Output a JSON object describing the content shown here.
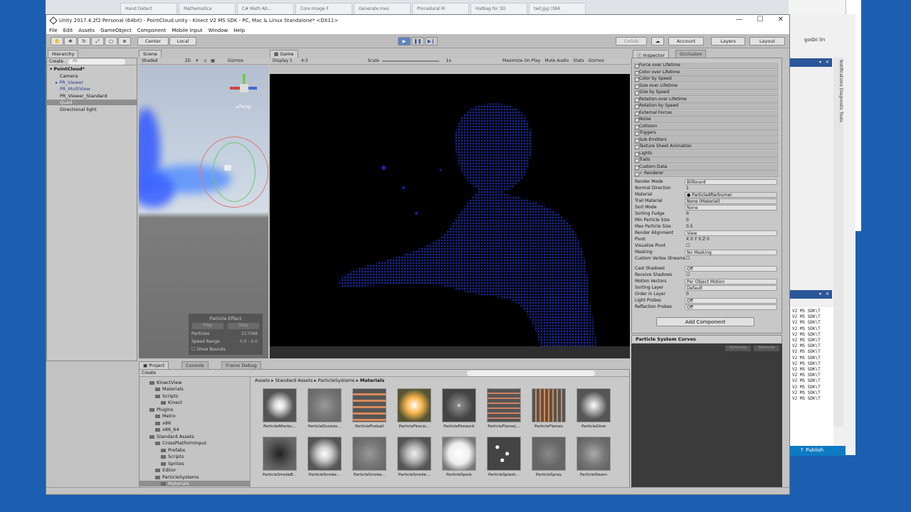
{
  "bg_tabs": [
    "Hand Detect",
    "Mathematica",
    "C# Math Ab...",
    "Core Image F",
    "Generate mes",
    "Procedural M",
    "Hatbag for 3D",
    "ted.jpg (384"
  ],
  "vs_window": {
    "user": "godzi lin",
    "sidebar": "Notifications  Diagnostic Tools",
    "list": [
      "V2 MS SDK\\T",
      "V2 MS SDK\\T",
      "V2 MS SDK\\T",
      "V2 MS SDK\\T",
      "V2 MS SDK\\T",
      "V2 MS SDK\\T",
      "V2 MS SDK\\T",
      "V2 MS SDK\\T",
      "V2 MS SDK\\T",
      "V2 MS SDK\\T",
      "V2 MS SDK\\T",
      "V2 MS SDK\\T",
      "V2 MS SDK\\T",
      "V2 MS SDK\\T",
      "V2 MS SDK\\T",
      "V2 MS SDK\\T"
    ],
    "publish": "Publish"
  },
  "window": {
    "title": "Unity 2017.4.2f2 Personal (64bit) - PointCloud.unity - Kinect V2 MS SDK - PC, Mac & Linux Standalone* <DX11>",
    "minimize": "—",
    "maximize": "☐",
    "close": "✕"
  },
  "menu": [
    "File",
    "Edit",
    "Assets",
    "GameObject",
    "Component",
    "Mobile Input",
    "Window",
    "Help"
  ],
  "toolbar": {
    "center": "Center",
    "local": "Local",
    "collab": "Collab",
    "account": "Account",
    "layers": "Layers",
    "layout": "Layout"
  },
  "hierarchy": {
    "tab": "Hierarchy",
    "create": "Create",
    "search": "All",
    "scene": "PointCloud*",
    "items": [
      "Camera",
      "PR_Viewer",
      "PR_MultiView",
      "PR_Viewer_Standard",
      "Quad",
      "Directional light"
    ]
  },
  "scene": {
    "tab": "Scene",
    "shaded": "Shaded",
    "mode2d": "2D",
    "gizmos": "Gizmos",
    "persp": "Persp",
    "particle_effect": {
      "title": "Particle Effect",
      "play": "Play",
      "stop": "Stop",
      "particles_label": "Particles",
      "particles_value": "217088",
      "speed_label": "Speed Range",
      "speed_value": "0.0 - 0.0",
      "bounds_label": "Show Bounds"
    }
  },
  "game": {
    "tab": "Game",
    "display": "Display 1",
    "aspect": "4:3",
    "scale_label": "Scale",
    "scale_value": "1x",
    "maximize": "Maximize On Play",
    "mute": "Mute Audio",
    "stats": "Stats",
    "gizmos": "Gizmos"
  },
  "inspector": {
    "tab": "Inspector",
    "occlusion_tab": "Occlusion",
    "modules": [
      "Force over Lifetime",
      "Color over Lifetime",
      "Color by Speed",
      "Size over Lifetime",
      "Size by Speed",
      "Rotation over Lifetime",
      "Rotation by Speed",
      "External Forces",
      "Noise",
      "Collision",
      "Triggers",
      "Sub Emitters",
      "Texture Sheet Animation",
      "Lights",
      "Trails",
      "Custom Data"
    ],
    "renderer_label": "Renderer",
    "props": [
      {
        "label": "Render Mode",
        "value": "Billboard"
      },
      {
        "label": "Normal Direction",
        "value": "1"
      },
      {
        "label": "Material",
        "value": "ParticleAfterburner"
      },
      {
        "label": "Trail Material",
        "value": "None (Material)"
      },
      {
        "label": "Sort Mode",
        "value": "None"
      },
      {
        "label": "Sorting Fudge",
        "value": "0"
      },
      {
        "label": "Min Particle Size",
        "value": "0"
      },
      {
        "label": "Max Particle Size",
        "value": "0.5"
      },
      {
        "label": "Render Alignment",
        "value": "View"
      },
      {
        "label": "Pivot",
        "value": "X 0     Y 0     Z 0"
      },
      {
        "label": "Visualize Pivot",
        "value": ""
      },
      {
        "label": "Masking",
        "value": "No Masking"
      },
      {
        "label": "Custom Vertex Streams",
        "value": ""
      },
      {
        "label": "Cast Shadows",
        "value": "Off"
      },
      {
        "label": "Receive Shadows",
        "value": ""
      },
      {
        "label": "Motion Vectors",
        "value": "Per Object Motion"
      },
      {
        "label": "Sorting Layer",
        "value": "Default"
      },
      {
        "label": "Order in Layer",
        "value": "0"
      },
      {
        "label": "Light Probes",
        "value": "Off"
      },
      {
        "label": "Reflection Probes",
        "value": "Off"
      }
    ],
    "add_component": "Add Component",
    "curves_title": "Particle System Curves",
    "optimize": "Optimize",
    "remove": "Remove"
  },
  "project": {
    "tab": "Project",
    "console_tab": "Console",
    "frame_tab": "Frame Debug",
    "create": "Create",
    "tree": [
      "KinectView",
      "Materials",
      "Scripts",
      "Kinect",
      "Plugins",
      "Metro",
      "x86",
      "x86_64",
      "Standard Assets",
      "CrossPlatformInput",
      "Prefabs",
      "Scripts",
      "Sprites",
      "Editor",
      "ParticleSystems",
      "Materials"
    ],
    "breadcrumb": [
      "Assets",
      "Standard Assets",
      "ParticleSystems",
      "Materials"
    ],
    "assets": [
      "ParticleAfterbu...",
      "ParticleDuststo...",
      "ParticleFireball",
      "ParticleFirecio...",
      "ParticleFirework",
      "ParticleFlameL...",
      "ParticleFlames",
      "ParticleGlow",
      "ParticleSmokeB...",
      "ParticleSmoke...",
      "ParticleSmoke...",
      "ParticleSmoke...",
      "ParticleSpark",
      "ParticleSplash...",
      "ParticleSpray",
      "ParticleSteam"
    ]
  },
  "colors": {
    "accent": "#5a84c6",
    "pointcloud": "#1a3cff",
    "desktop": "#1c5fb0"
  }
}
